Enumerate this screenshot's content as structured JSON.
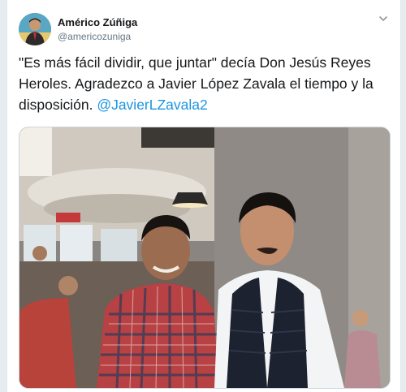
{
  "tweet": {
    "author_name": "Américo Zúñiga",
    "author_handle": "@americozuniga",
    "text_main": "\"Es más fácil dividir, que juntar\" decía Don Jesús Reyes Heroles. Agradezco a Javier López Zavala el tiempo y la disposición. ",
    "mention": "@JavierLZavala2"
  },
  "icons": {
    "caret": "chevron-down-icon",
    "avatar": "avatar"
  },
  "colors": {
    "link": "#1b95e0",
    "text": "#14171a",
    "secondary": "#657786",
    "border": "#e1e8ed"
  }
}
